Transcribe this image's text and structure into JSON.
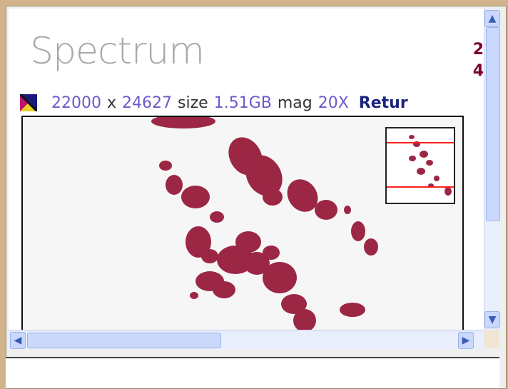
{
  "app": {
    "logo_text": "Spectrum",
    "side_digits": [
      "2",
      "4"
    ]
  },
  "image_info": {
    "width": "22000",
    "times": "x",
    "height": "24627",
    "size_label": "size",
    "size_value": "1.51GB",
    "mag_label": "mag",
    "mag_value": "20X",
    "return_label": "Retur"
  },
  "colors": {
    "tissue": "#9b2745",
    "link": "#6a5acd",
    "return": "#1a237e",
    "thumb_marker": "#ff2020"
  },
  "icons": [
    "image-color-icon",
    "arrow-up-icon",
    "arrow-down-icon",
    "arrow-left-icon",
    "arrow-right-icon"
  ]
}
